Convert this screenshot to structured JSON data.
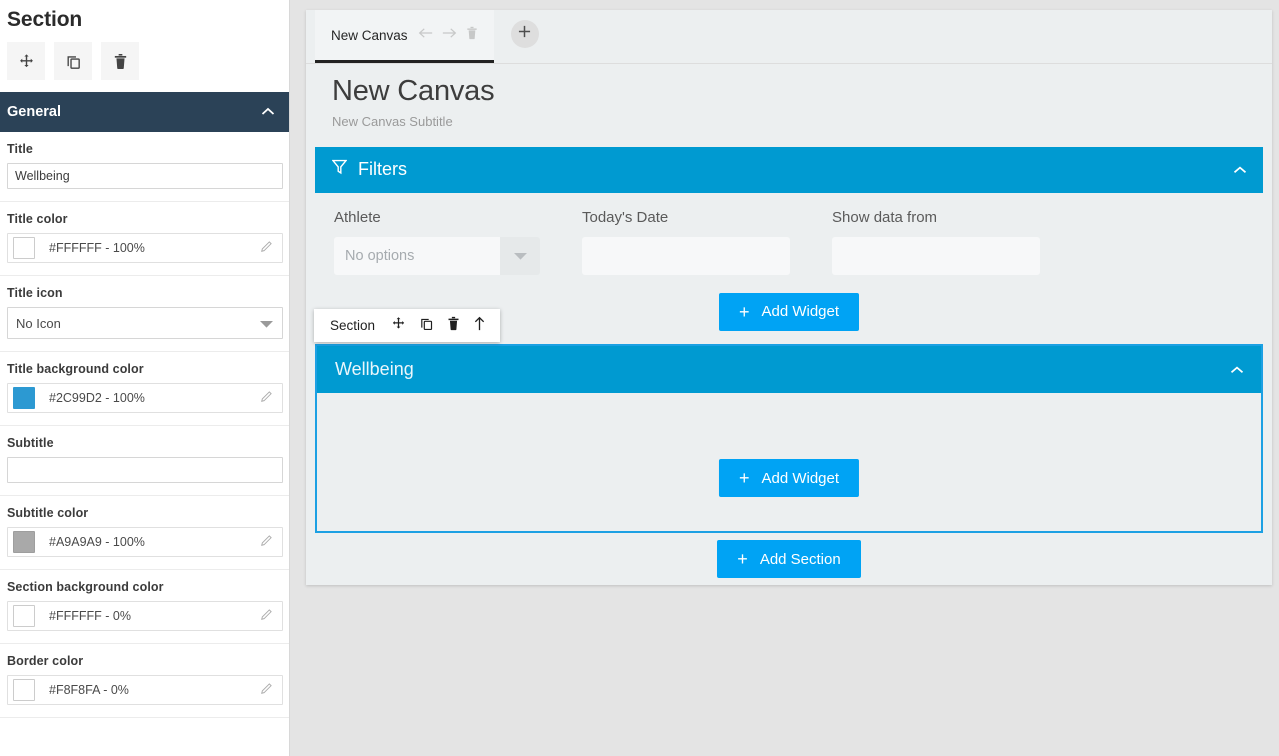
{
  "sidebar": {
    "title": "Section",
    "toolbar": [
      {
        "name": "move-icon",
        "label": "Move"
      },
      {
        "name": "duplicate-icon",
        "label": "Duplicate"
      },
      {
        "name": "delete-icon",
        "label": "Delete"
      }
    ],
    "section_header": {
      "label": "General",
      "chevron": "chevron-up-icon"
    },
    "fields": {
      "title": {
        "label": "Title",
        "value": "Wellbeing",
        "placeholder": ""
      },
      "title_color": {
        "label": "Title color",
        "value": "#FFFFFF - 100%",
        "swatch": "#FFFFFF"
      },
      "title_icon": {
        "label": "Title icon",
        "value": "No Icon"
      },
      "title_bg_color": {
        "label": "Title background color",
        "value": "#2C99D2 - 100%",
        "swatch": "#2C99D2"
      },
      "subtitle": {
        "label": "Subtitle",
        "value": "",
        "placeholder": ""
      },
      "subtitle_color": {
        "label": "Subtitle color",
        "value": "#A9A9A9 - 100%",
        "swatch": "#A9A9A9"
      },
      "section_bg_color": {
        "label": "Section background color",
        "value": "#FFFFFF - 0%",
        "swatch": "#FFFFFF"
      },
      "border_color": {
        "label": "Border color",
        "value": "#F8F8FA - 0%",
        "swatch": "#FFFFFF"
      }
    }
  },
  "tabbar": {
    "tabs": [
      {
        "label": "New Canvas",
        "active": true
      }
    ],
    "icons": [
      {
        "name": "arrow-left-icon"
      },
      {
        "name": "arrow-right-icon"
      },
      {
        "name": "delete-icon"
      }
    ],
    "add_tab": {
      "name": "add-tab-icon",
      "label": "+"
    }
  },
  "canvas": {
    "title": "New Canvas",
    "subtitle": "New Canvas Subtitle"
  },
  "filters": {
    "title": "Filters",
    "icon": "filter-icon",
    "chevron": "chevron-up-icon",
    "fields": [
      {
        "label": "Athlete",
        "type": "select",
        "value": "No options",
        "placeholder": "No options"
      },
      {
        "label": "Today's Date",
        "type": "text",
        "value": "",
        "placeholder": ""
      },
      {
        "label": "Show data from",
        "type": "text",
        "value": "",
        "placeholder": ""
      }
    ],
    "add_widget_label": "Add Widget"
  },
  "section_toolbar": {
    "label": "Section",
    "icons": [
      {
        "name": "move-icon"
      },
      {
        "name": "duplicate-icon"
      },
      {
        "name": "delete-icon"
      },
      {
        "name": "arrow-up-icon"
      }
    ]
  },
  "section": {
    "title": "Wellbeing",
    "chevron": "chevron-up-icon",
    "add_widget_label": "Add Widget"
  },
  "footer": {
    "add_section_label": "Add Section"
  },
  "colors": {
    "accent_blue": "#009AD1",
    "button_blue": "#00A3F4",
    "selection_blue": "#1CA0E3",
    "sidebar_header": "#2B4257",
    "page_bg": "#E4E4E4",
    "canvas_bg": "#ECEFF0"
  },
  "plus_glyph": "+"
}
